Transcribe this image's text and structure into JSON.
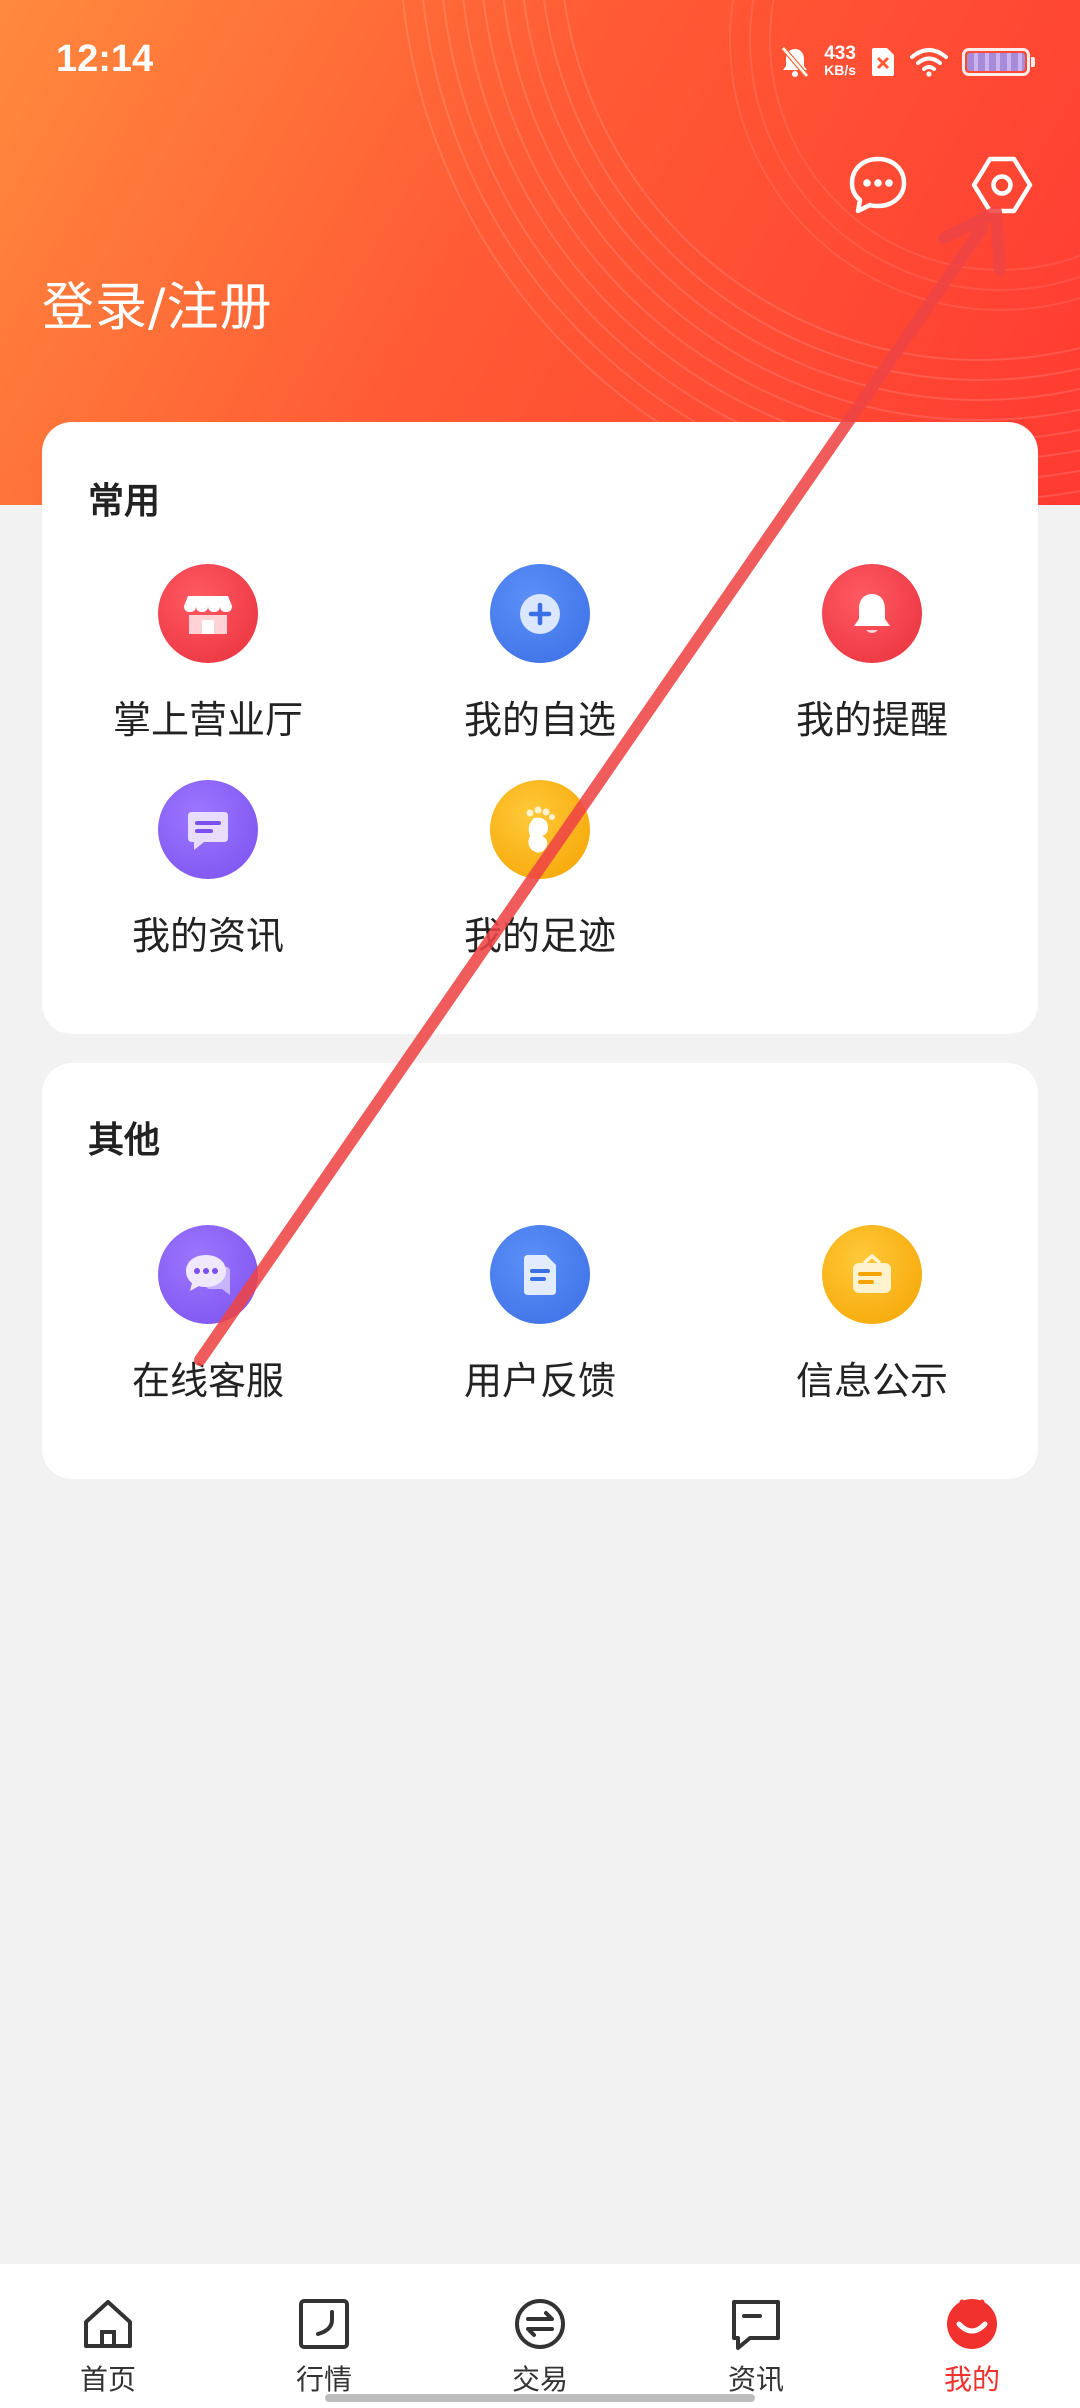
{
  "status_bar": {
    "time": "12:14",
    "net_speed_value": "433",
    "net_speed_unit": "KB/s",
    "icons": [
      "bell-muted-icon",
      "sim-off-icon",
      "wifi-icon",
      "battery-icon"
    ]
  },
  "header": {
    "title": "登录/注册",
    "message_icon": "chat-bubble-icon",
    "settings_icon": "settings-hexagon-icon"
  },
  "common": {
    "title": "常用",
    "items": [
      {
        "label": "掌上营业厅",
        "icon": "store-icon",
        "color": "#e8303c"
      },
      {
        "label": "我的自选",
        "icon": "plus-circle-icon",
        "color": "#3b6fe5"
      },
      {
        "label": "我的提醒",
        "icon": "bell-icon",
        "color": "#e8303c"
      },
      {
        "label": "我的资讯",
        "icon": "message-card-icon",
        "color": "#7a50ee"
      },
      {
        "label": "我的足迹",
        "icon": "footprint-icon",
        "color": "#f5a300"
      }
    ]
  },
  "other": {
    "title": "其他",
    "items": [
      {
        "label": "在线客服",
        "icon": "chat-service-icon",
        "color": "#7a50ee"
      },
      {
        "label": "用户反馈",
        "icon": "document-icon",
        "color": "#3b6fe5"
      },
      {
        "label": "信息公示",
        "icon": "bulletin-bag-icon",
        "color": "#f5a300"
      }
    ]
  },
  "bottom_nav": {
    "items": [
      {
        "label": "首页",
        "icon": "home-icon"
      },
      {
        "label": "行情",
        "icon": "market-chart-icon"
      },
      {
        "label": "交易",
        "icon": "exchange-icon"
      },
      {
        "label": "资讯",
        "icon": "news-icon"
      },
      {
        "label": "我的",
        "icon": "profile-face-icon"
      }
    ],
    "active_index": 4,
    "active_color": "#f0312e"
  }
}
